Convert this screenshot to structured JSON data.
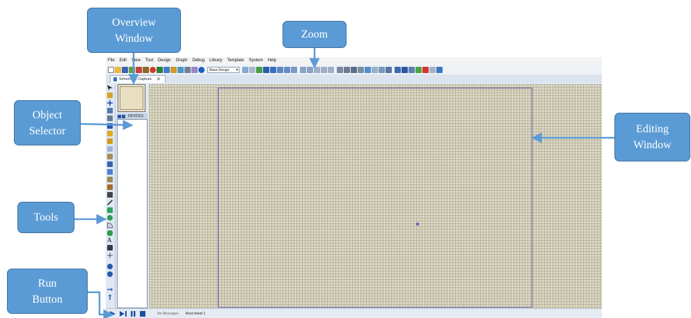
{
  "callouts": {
    "overview": [
      "Overview",
      "Window"
    ],
    "zoom": "Zoom",
    "object_selector": [
      "Object",
      "Selector"
    ],
    "editing": [
      "Editing",
      "Window"
    ],
    "tools": "Tools",
    "run": [
      "Run",
      "Button"
    ]
  },
  "app": {
    "menu": [
      "File",
      "Edit",
      "View",
      "Tool",
      "Design",
      "Graph",
      "Debug",
      "Library",
      "Template",
      "System",
      "Help"
    ],
    "layer_combo": "Base Design",
    "tab_label": "Schematic Capture",
    "tab_close": "✕",
    "object_selector_header": "DEVICES",
    "status_message": "No Messages",
    "status_sheet": "Root sheet 1"
  },
  "colors": {
    "callout_fill": "#5b9bd5",
    "callout_border": "#3f6f9e",
    "grid_background": "#dcd8c4",
    "sheet_border": "#5a5aa6"
  }
}
